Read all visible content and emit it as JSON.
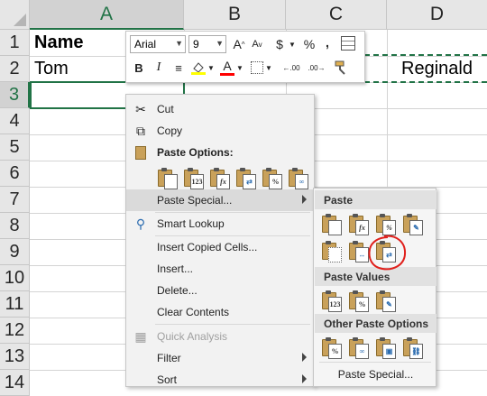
{
  "sheet": {
    "columns": [
      {
        "label": "A",
        "selected": true
      },
      {
        "label": "B",
        "selected": false
      },
      {
        "label": "C",
        "selected": false
      },
      {
        "label": "D",
        "selected": false
      }
    ],
    "rows": [
      "1",
      "2",
      "3",
      "4",
      "5",
      "6",
      "7",
      "8",
      "9",
      "10",
      "11",
      "12",
      "13",
      "14"
    ],
    "selected_row": "3",
    "cells": {
      "A1": "Name",
      "A2": "Tom",
      "D2": "Reginald"
    },
    "colors": {
      "header_bg": "#e6e6e6",
      "selection": "#217346",
      "grid": "#d4d4d4"
    }
  },
  "mini_toolbar": {
    "font_name": "Arial",
    "font_size": "9",
    "grow_font": "A",
    "shrink_font": "A",
    "currency": "$",
    "percent": "%",
    "comma": ",",
    "bold": "B",
    "italic": "I",
    "font_color_label": "A",
    "increase_decimal": ".00",
    "decrease_decimal": ".00",
    "font_color": "#ff0000",
    "fill_color": "#ffff00"
  },
  "context_menu": {
    "cut": "Cut",
    "copy": "Copy",
    "paste_options_header": "Paste Options:",
    "paste_options_icons": [
      "paste-icon",
      "paste-values-icon",
      "paste-formulas-icon",
      "paste-transpose-icon",
      "paste-formatting-icon",
      "paste-link-icon"
    ],
    "paste_options_text": [
      "123",
      "fx"
    ],
    "paste_special": "Paste Special...",
    "smart_lookup": "Smart Lookup",
    "insert_copied_cells": "Insert Copied Cells...",
    "insert": "Insert...",
    "delete": "Delete...",
    "clear_contents": "Clear Contents",
    "quick_analysis": "Quick Analysis",
    "filter": "Filter",
    "sort": "Sort"
  },
  "paste_special_submenu": {
    "paste_header": "Paste",
    "values_header": "Paste Values",
    "other_header": "Other Paste Options",
    "paste_special": "Paste Special...",
    "annotation_color": "#e0201c"
  }
}
